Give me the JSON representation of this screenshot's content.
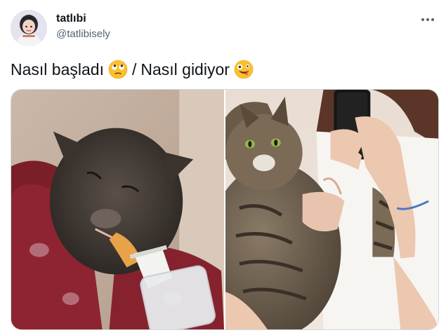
{
  "tweet": {
    "display_name": "tatlıbi",
    "handle": "@tatlibisely",
    "text_part1": "Nasıl başladı",
    "separator": "/",
    "text_part2": "Nasıl gidiyor",
    "emoji_1": "face-with-rolling-eyes-icon",
    "emoji_2": "zany-face-icon"
  },
  "media": {
    "photos": [
      {
        "subject": "kitten-bottle-feeding-photo"
      },
      {
        "subject": "fluffy-tabby-cat-held-photo"
      }
    ]
  },
  "colors": {
    "text_primary": "#0f1419",
    "text_secondary": "#536471",
    "border": "#cfd9de",
    "emoji_yellow": "#fbc02d"
  }
}
